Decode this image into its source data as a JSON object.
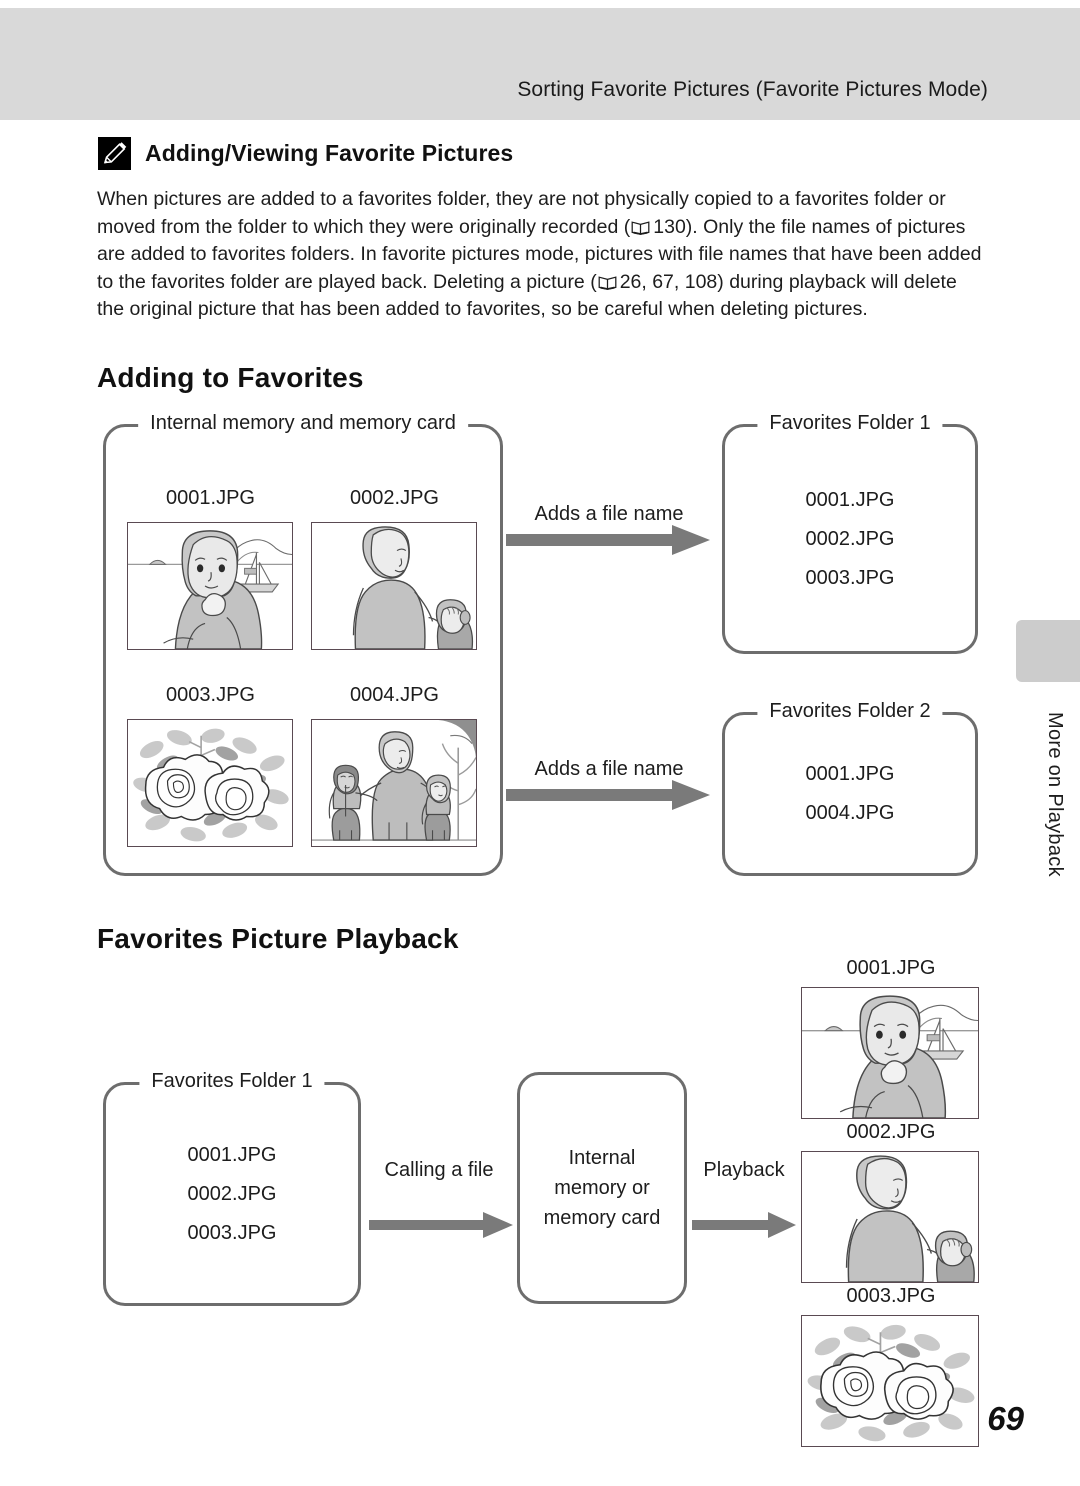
{
  "header": {
    "running_title": "Sorting Favorite Pictures (Favorite Pictures Mode)"
  },
  "note": {
    "icon": "pencil-note-icon",
    "heading": "Adding/Viewing Favorite Pictures",
    "paragraph_part1": "When pictures are added to a favorites folder, they are not physically copied to a favorites folder or moved from the folder to which they were originally recorded (",
    "ref1": "130",
    "paragraph_part2": "). Only the file names of pictures are added to favorites folders. In favorite pictures mode, pictures with file names that have been added to the favorites folder are played back. Deleting a picture (",
    "ref2": "26, 67, 108",
    "paragraph_part3": ") during playback will delete the original picture that has been added to favorites, so be careful when deleting pictures."
  },
  "sections": {
    "adding_title": "Adding to Favorites",
    "playback_title": "Favorites Picture Playback"
  },
  "adding_diagram": {
    "source_box_legend": "Internal memory and memory card",
    "thumbnails": [
      {
        "label": "0001.JPG",
        "scene": "woman-with-sailboat"
      },
      {
        "label": "0002.JPG",
        "scene": "woman-with-child"
      },
      {
        "label": "0003.JPG",
        "scene": "flowers"
      },
      {
        "label": "0004.JPG",
        "scene": "woman-with-two-children"
      }
    ],
    "arrow1_label": "Adds a file name",
    "arrow2_label": "Adds a file name",
    "folder1": {
      "legend": "Favorites Folder 1",
      "files": [
        "0001.JPG",
        "0002.JPG",
        "0003.JPG"
      ]
    },
    "folder2": {
      "legend": "Favorites Folder 2",
      "files": [
        "0001.JPG",
        "0004.JPG"
      ]
    }
  },
  "playback_diagram": {
    "folder1": {
      "legend": "Favorites Folder 1",
      "files": [
        "0001.JPG",
        "0002.JPG",
        "0003.JPG"
      ]
    },
    "arrow1_label": "Calling a file",
    "memory_box_lines": [
      "Internal",
      "memory or",
      "memory card"
    ],
    "arrow2_label": "Playback",
    "thumbnails": [
      {
        "label": "0001.JPG",
        "scene": "woman-with-sailboat"
      },
      {
        "label": "0002.JPG",
        "scene": "woman-with-child"
      },
      {
        "label": "0003.JPG",
        "scene": "flowers"
      }
    ]
  },
  "side_tab": {
    "label": "More on Playback"
  },
  "page_number": "69",
  "colors": {
    "header_band": "#d9d9d9",
    "box_stroke": "#6d6d6d",
    "arrow_fill": "#7a7a7a",
    "tab_gray": "#cccccc"
  }
}
